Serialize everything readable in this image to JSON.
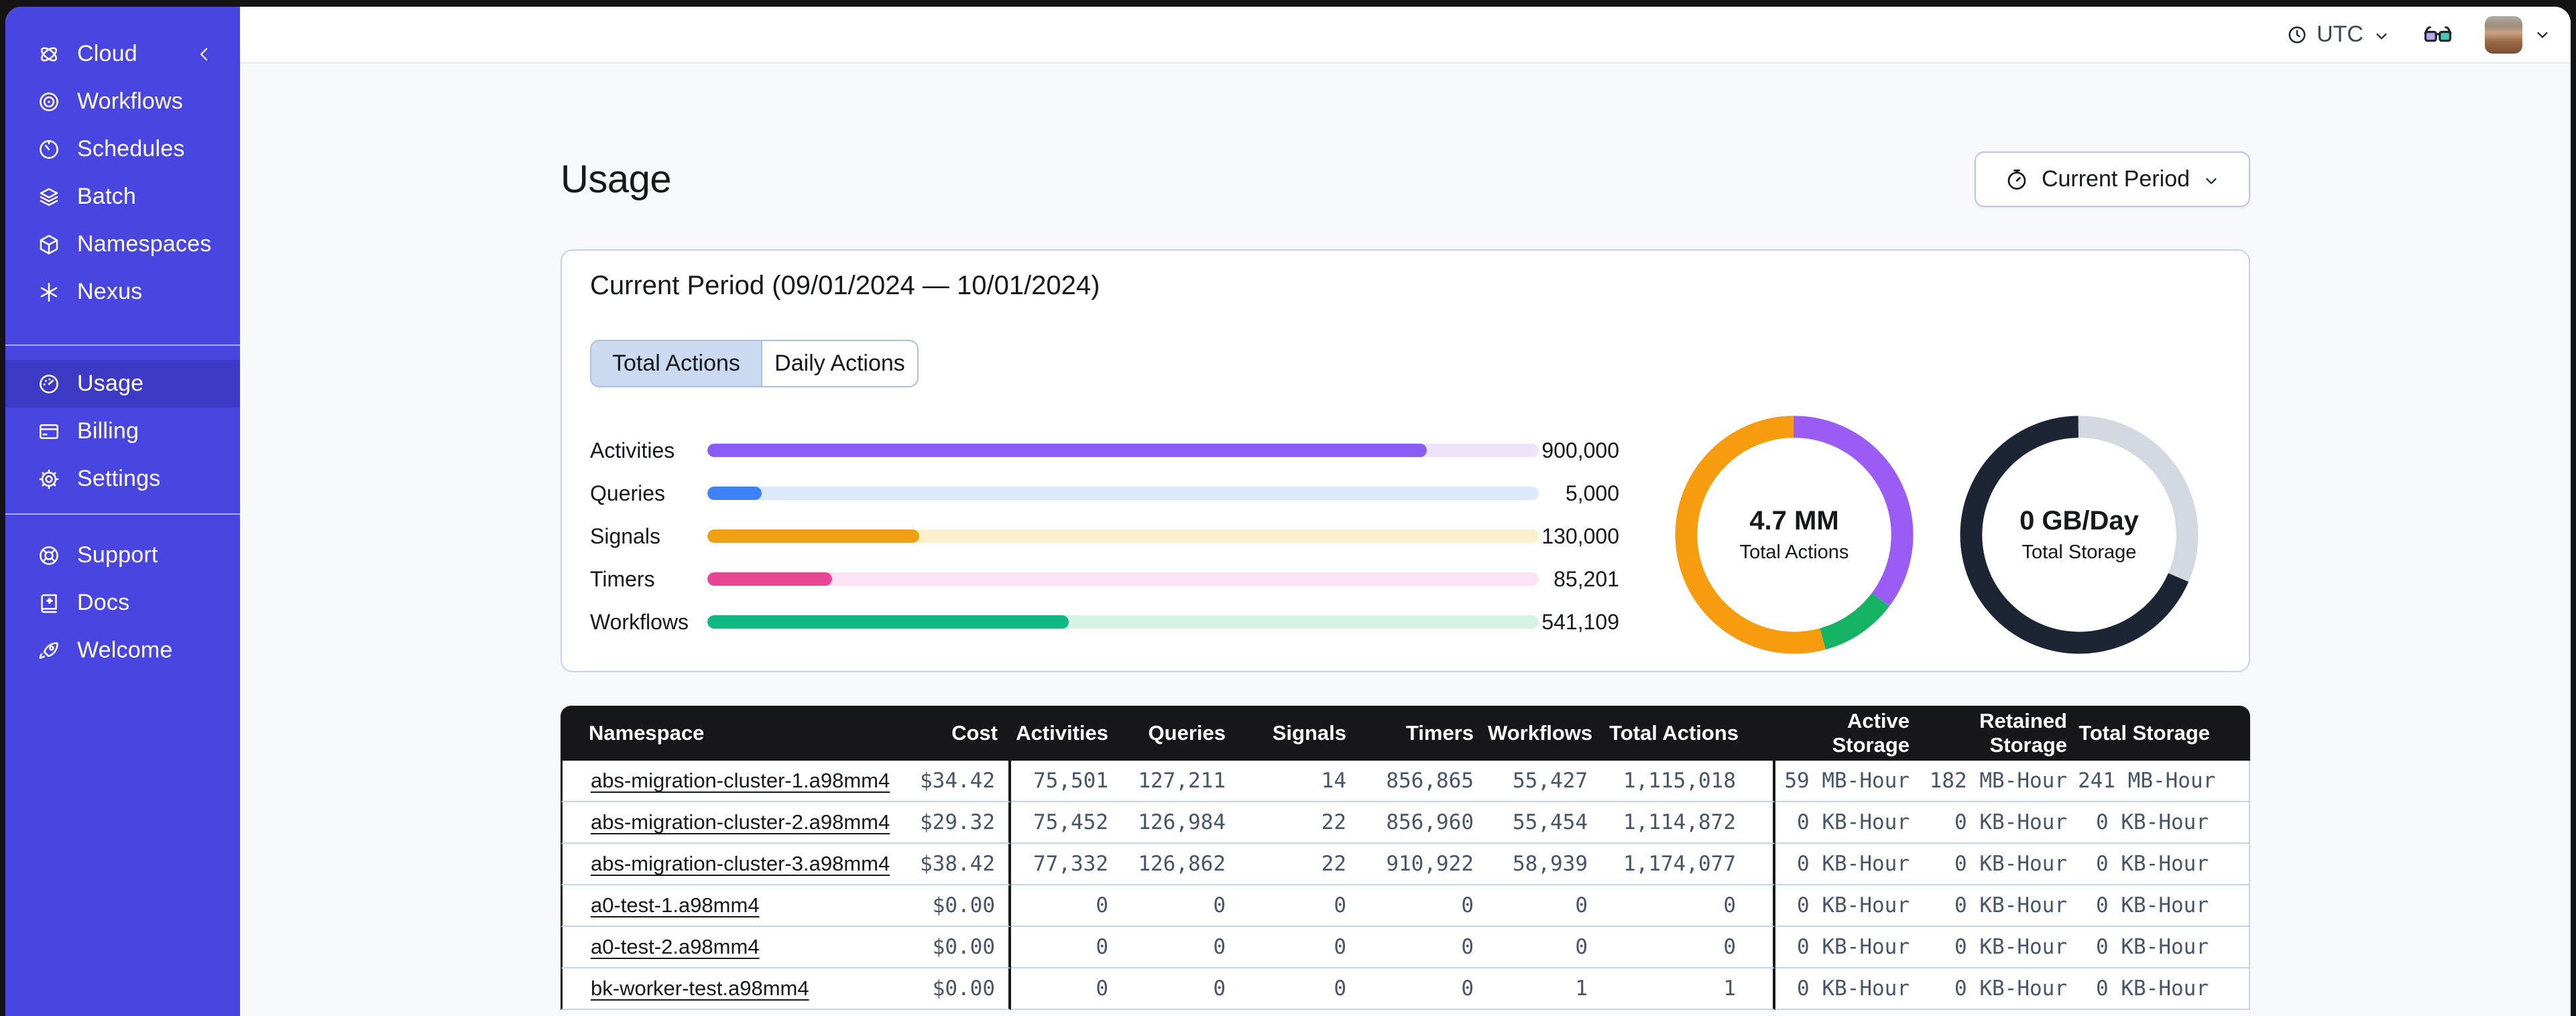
{
  "colors": {
    "sidebar_bg": "#4845E0",
    "sidebar_active_bg": "#3D3AC6",
    "page_bg": "#F8F9FC",
    "table_header_bg": "#17171A",
    "table_text": "#475569",
    "card_border": "#C6D1EC",
    "accent_purple": "#8B5CF6",
    "accent_blue": "#3E82F7",
    "accent_orange": "#F0A014",
    "accent_pink": "#E74694",
    "accent_green": "#10B981",
    "donut_navy": "#1D2433"
  },
  "sidebar": {
    "brand": {
      "label": "Cloud",
      "icon": "temporal-cloud-icon"
    },
    "main_items": [
      {
        "label": "Workflows",
        "icon": "workflows",
        "active": false
      },
      {
        "label": "Schedules",
        "icon": "schedules",
        "active": false
      },
      {
        "label": "Batch",
        "icon": "batch",
        "active": false
      },
      {
        "label": "Namespaces",
        "icon": "namespaces",
        "active": false
      },
      {
        "label": "Nexus",
        "icon": "nexus",
        "active": false
      }
    ],
    "account_items": [
      {
        "label": "Usage",
        "icon": "usage",
        "active": true
      },
      {
        "label": "Billing",
        "icon": "billing",
        "active": false
      },
      {
        "label": "Settings",
        "icon": "settings",
        "active": false
      }
    ],
    "footer_items": [
      {
        "label": "Support",
        "icon": "support",
        "active": false
      },
      {
        "label": "Docs",
        "icon": "docs",
        "active": false
      },
      {
        "label": "Welcome",
        "icon": "welcome",
        "active": false
      }
    ]
  },
  "topbar": {
    "timezone_label": "UTC"
  },
  "page": {
    "title": "Usage",
    "period_button": {
      "label": "Current Period",
      "icon": "stopwatch-icon"
    }
  },
  "panel": {
    "title": "Current Period (09/01/2024 — 10/01/2024)",
    "tabs": [
      {
        "label": "Total Actions",
        "selected": true
      },
      {
        "label": "Daily Actions",
        "selected": false
      }
    ]
  },
  "chart_data": [
    {
      "type": "bar",
      "orientation": "horizontal",
      "categories": [
        "Activities",
        "Queries",
        "Signals",
        "Timers",
        "Workflows"
      ],
      "values": [
        900000,
        5000,
        130000,
        85201,
        541109
      ],
      "value_labels": [
        "900,000",
        "5,000",
        "130,000",
        "85,201",
        "541,109"
      ],
      "bar_pcts": [
        86.5,
        6.5,
        25.5,
        15,
        43.5
      ],
      "fill_colors": [
        "#8B5CF6",
        "#3E82F7",
        "#F0A014",
        "#E74694",
        "#10B981"
      ],
      "track_colors": [
        "#EDE4FC",
        "#DCE8FC",
        "#FBF0CE",
        "#FCE3F3",
        "#D6F3E5"
      ],
      "xlim": [
        0,
        1000000
      ],
      "title": "",
      "xlabel": "",
      "ylabel": ""
    },
    {
      "type": "donut",
      "center_value": "4.7 MM",
      "center_label": "Total Actions",
      "segments": [
        {
          "name": "segment-purple",
          "color": "#9B5CF6",
          "pct": 35.3
        },
        {
          "name": "segment-green",
          "color": "#16B364",
          "pct": 10.5
        },
        {
          "name": "segment-orange",
          "color": "#F79C0E",
          "pct": 54.2
        }
      ]
    },
    {
      "type": "donut",
      "center_value": "0 GB/Day",
      "center_label": "Total Storage",
      "segments": [
        {
          "name": "segment-gray",
          "color": "#D4D8E1",
          "pct": 31.5
        },
        {
          "name": "segment-navy",
          "color": "#1D2433",
          "pct": 68.5
        }
      ]
    }
  ],
  "table": {
    "columns": [
      "Namespace",
      "Cost",
      "Activities",
      "Queries",
      "Signals",
      "Timers",
      "Workflows",
      "Total Actions",
      "Active Storage",
      "Retained Storage",
      "Total Storage"
    ],
    "rows": [
      [
        "abs-migration-cluster-1.a98mm4",
        "$34.42",
        "75,501",
        "127,211",
        "14",
        "856,865",
        "55,427",
        "1,115,018",
        "59 MB-Hour",
        "182 MB-Hour",
        "241 MB-Hour"
      ],
      [
        "abs-migration-cluster-2.a98mm4",
        "$29.32",
        "75,452",
        "126,984",
        "22",
        "856,960",
        "55,454",
        "1,114,872",
        "0 KB-Hour",
        "0 KB-Hour",
        "0 KB-Hour"
      ],
      [
        "abs-migration-cluster-3.a98mm4",
        "$38.42",
        "77,332",
        "126,862",
        "22",
        "910,922",
        "58,939",
        "1,174,077",
        "0 KB-Hour",
        "0 KB-Hour",
        "0 KB-Hour"
      ],
      [
        "a0-test-1.a98mm4",
        "$0.00",
        "0",
        "0",
        "0",
        "0",
        "0",
        "0",
        "0 KB-Hour",
        "0 KB-Hour",
        "0 KB-Hour"
      ],
      [
        "a0-test-2.a98mm4",
        "$0.00",
        "0",
        "0",
        "0",
        "0",
        "0",
        "0",
        "0 KB-Hour",
        "0 KB-Hour",
        "0 KB-Hour"
      ],
      [
        "bk-worker-test.a98mm4",
        "$0.00",
        "0",
        "0",
        "0",
        "0",
        "1",
        "1",
        "0 KB-Hour",
        "0 KB-Hour",
        "0 KB-Hour"
      ]
    ]
  }
}
